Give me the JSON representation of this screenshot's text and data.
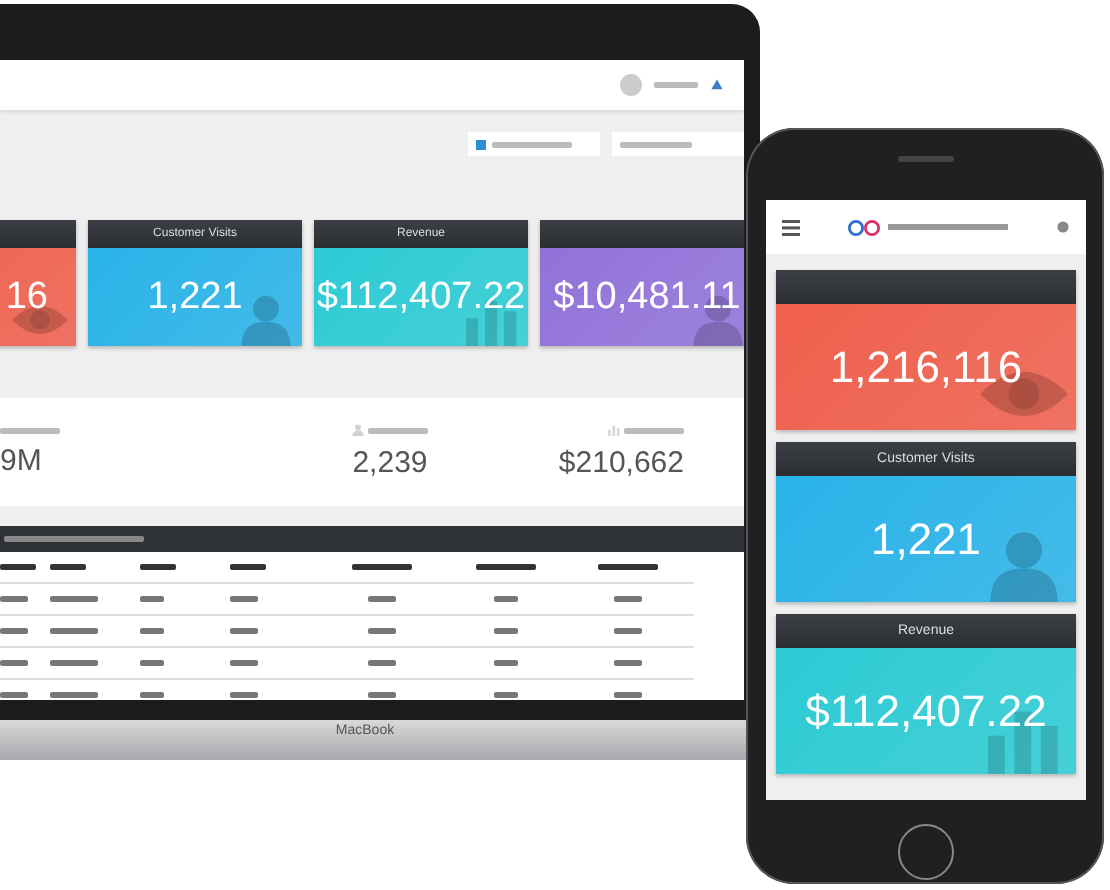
{
  "laptop": {
    "cards": [
      {
        "value": "16",
        "color": "#ef5f4c",
        "kind": "eye"
      },
      {
        "title": "Customer Visits",
        "value": "1,221",
        "color": "#29b3e8",
        "kind": "person"
      },
      {
        "title": "Revenue",
        "value": "$112,407.22",
        "color": "#2ccbd4",
        "kind": "chart"
      },
      {
        "value": "$10,481.11",
        "color": "#9172d9",
        "kind": "person"
      }
    ],
    "stats": [
      {
        "value": "9M"
      },
      {
        "value": "2,239",
        "kind": "person"
      },
      {
        "value": "$210,662",
        "kind": "chart"
      }
    ],
    "label": "MacBook"
  },
  "phone": {
    "cards": [
      {
        "value": "1,216,116",
        "color": "#ef5f4c",
        "kind": "eye"
      },
      {
        "title": "Customer Visits",
        "value": "1,221",
        "color": "#29b3e8",
        "kind": "person"
      },
      {
        "title": "Revenue",
        "value": "$112,407.22",
        "color": "#2ccbd4",
        "kind": "chart"
      }
    ]
  }
}
